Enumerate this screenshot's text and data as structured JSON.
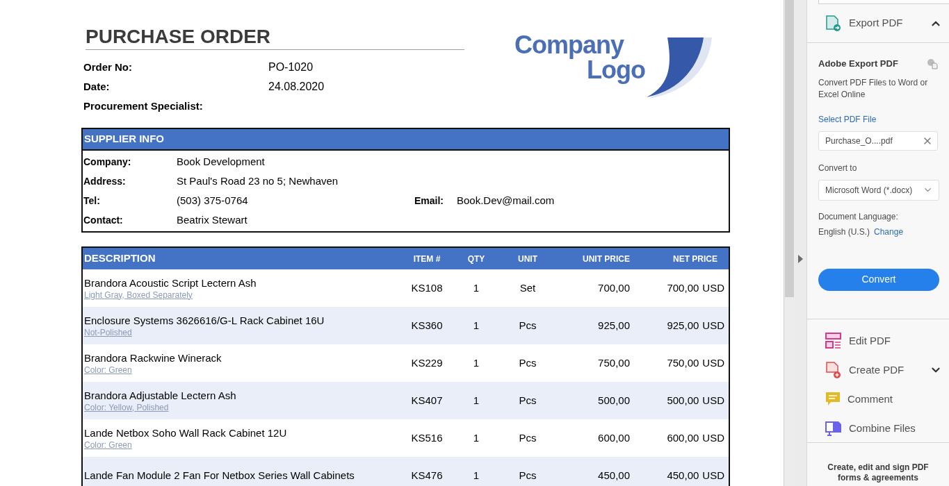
{
  "document": {
    "title": "PURCHASE ORDER",
    "fields": [
      {
        "label": "Order No:",
        "value": "PO-1020"
      },
      {
        "label": "Date:",
        "value": "24.08.2020"
      },
      {
        "label": "Procurement Specialist:"
      }
    ],
    "logo": {
      "line_1": "Company",
      "line_2": "Logo"
    },
    "supplier": {
      "heading": "SUPPLIER INFO",
      "rows": [
        {
          "label": "Company:",
          "value": "Book Development"
        },
        {
          "label": "Address:",
          "value": "St Paul's Road 23 no 5; Newhaven"
        },
        {
          "label": "Tel:",
          "value": "(503) 375-0764"
        },
        {
          "label": "Contact:",
          "value": "Beatrix Stewart"
        }
      ],
      "email": {
        "label": "Email:",
        "value": "Book.Dev@mail.com"
      }
    },
    "items": {
      "columns": [
        "DESCRIPTION",
        "ITEM #",
        "QTY",
        "UNIT",
        "UNIT PRICE",
        "NET PRICE"
      ],
      "rows": [
        {
          "description": "Brandora Acoustic Script Lectern Ash",
          "note": "Light Gray, Boxed Separately",
          "item": "KS108",
          "qty": "1",
          "unit": "Set",
          "unit_price": "700,00",
          "net_price": "700,00",
          "currency": "USD"
        },
        {
          "description": "Enclosure Systems 3626616/G-L Rack Cabinet 16U",
          "note": "Not-Polished",
          "item": "KS360",
          "qty": "1",
          "unit": "Pcs",
          "unit_price": "925,00",
          "net_price": "925,00",
          "currency": "USD"
        },
        {
          "description": "Brandora Rackwine Winerack",
          "note": "Color: Green",
          "item": "KS229",
          "qty": "1",
          "unit": "Pcs",
          "unit_price": "750,00",
          "net_price": "750,00",
          "currency": "USD"
        },
        {
          "description": "Brandora Adjustable Lectern Ash",
          "note": "Color: Yellow, Polished",
          "item": "KS407",
          "qty": "1",
          "unit": "Pcs",
          "unit_price": "500,00",
          "net_price": "500,00",
          "currency": "USD"
        },
        {
          "description": "Lande Netbox Soho Wall Rack Cabinet 12U",
          "note": "Color: Green",
          "item": "KS516",
          "qty": "1",
          "unit": "Pcs",
          "unit_price": "600,00",
          "net_price": "600,00",
          "currency": "USD"
        },
        {
          "description": "Lande Fan Module 2 Fan For Netbox Series Wall Cabinets",
          "item": "KS476",
          "qty": "1",
          "unit": "Pcs",
          "unit_price": "450,00",
          "net_price": "450,00",
          "currency": "USD"
        }
      ]
    }
  },
  "panel": {
    "export": {
      "title": "Export PDF",
      "expanded": true,
      "heading": "Adobe Export PDF",
      "description": "Convert PDF Files to Word or Excel Online",
      "select_label": "Select PDF File",
      "file": "Purchase_O....pdf",
      "convert_label": "Convert to",
      "format": "Microsoft Word (*.docx)",
      "language_label": "Document Language:",
      "language": "English (U.S.)",
      "change": "Change",
      "button": "Convert"
    },
    "tools": [
      {
        "kind": "edit",
        "label": "Edit PDF",
        "has_menu": false
      },
      {
        "kind": "create",
        "label": "Create PDF",
        "has_menu": true
      },
      {
        "kind": "comment",
        "label": "Comment",
        "has_menu": false
      },
      {
        "kind": "combine",
        "label": "Combine Files",
        "has_menu": false
      }
    ],
    "promo": "Create, edit and sign PDF forms & agreements"
  }
}
